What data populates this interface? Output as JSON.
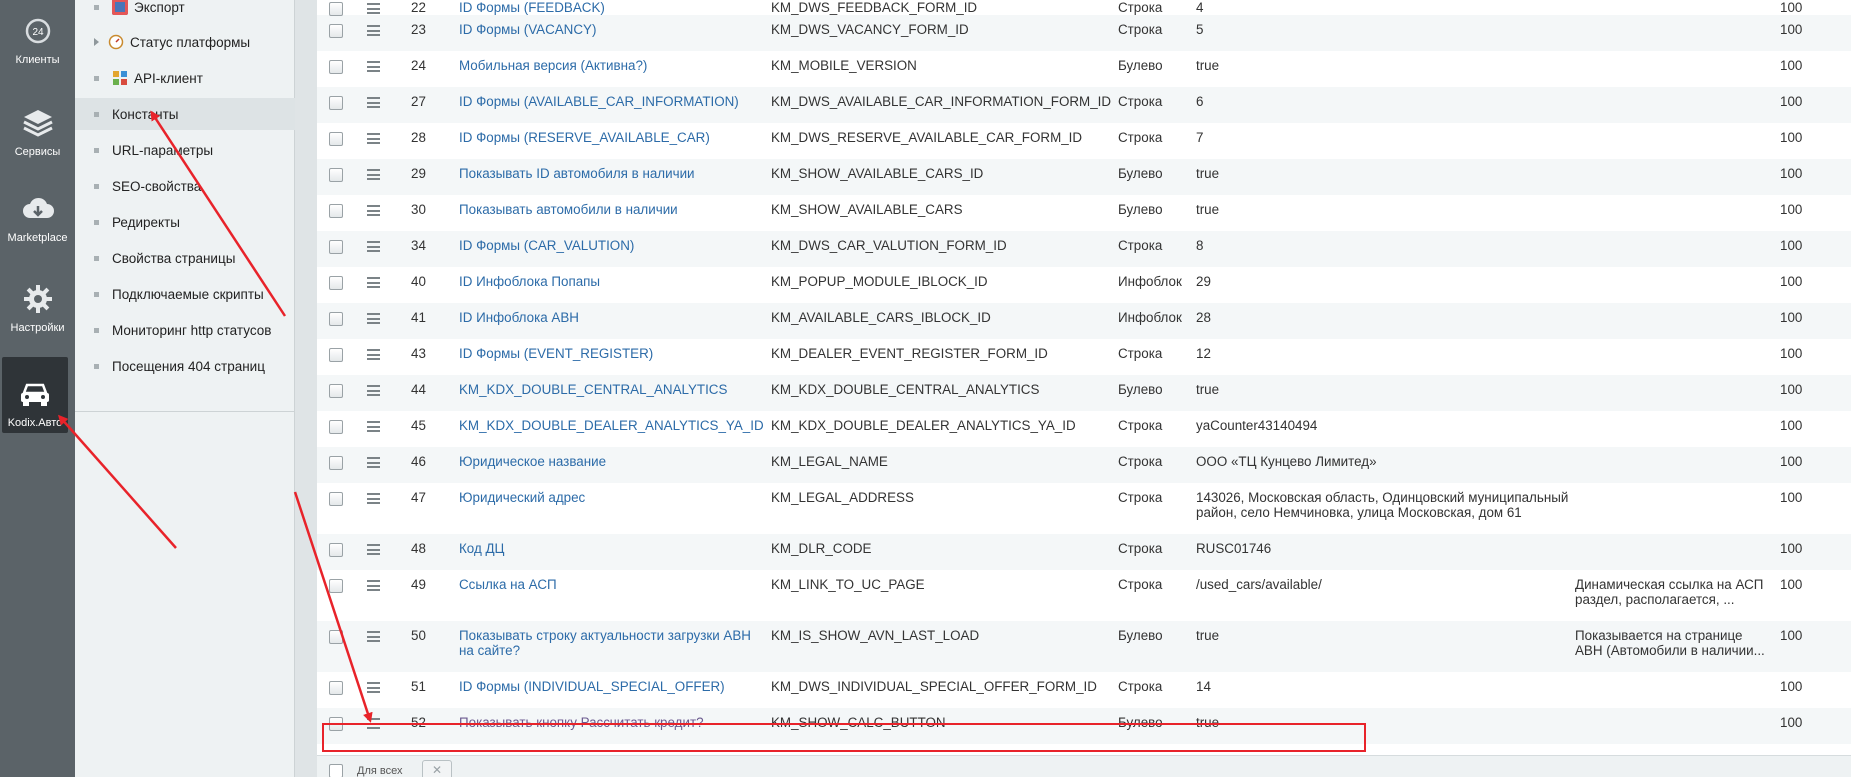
{
  "rail": {
    "items": [
      {
        "label": "Клиенты",
        "icon": "clients-24-icon"
      },
      {
        "label": "Сервисы",
        "icon": "layers-icon"
      },
      {
        "label": "Marketplace",
        "icon": "cloud-download-icon"
      },
      {
        "label": "Настройки",
        "icon": "gear-icon"
      },
      {
        "label": "Kodix.Авто",
        "icon": "car-icon"
      }
    ],
    "badge": "24"
  },
  "submenu": {
    "items": [
      {
        "label": "Экспорт"
      },
      {
        "label": "Статус платформы"
      },
      {
        "label": "API-клиент"
      },
      {
        "label": "Константы"
      },
      {
        "label": "URL-параметры"
      },
      {
        "label": "SEO-свойства"
      },
      {
        "label": "Редиректы"
      },
      {
        "label": "Свойства страницы"
      },
      {
        "label": "Подключаемые скрипты"
      },
      {
        "label": "Мониторинг http статусов"
      },
      {
        "label": "Посещения 404 страниц"
      }
    ]
  },
  "table": {
    "rows": [
      {
        "id": "22",
        "name": "ID Формы (FEEDBACK)",
        "code": "KM_DWS_FEEDBACK_FORM_ID",
        "type": "Строка",
        "value": "4",
        "desc": "",
        "sort": "100"
      },
      {
        "id": "23",
        "name": "ID Формы (VACANCY)",
        "code": "KM_DWS_VACANCY_FORM_ID",
        "type": "Строка",
        "value": "5",
        "desc": "",
        "sort": "100"
      },
      {
        "id": "24",
        "name": "Мобильная версия (Активна?)",
        "code": "KM_MOBILE_VERSION",
        "type": "Булево",
        "value": "true",
        "desc": "",
        "sort": "100"
      },
      {
        "id": "27",
        "name": "ID Формы (AVAILABLE_CAR_INFORMATION)",
        "code": "KM_DWS_AVAILABLE_CAR_INFORMATION_FORM_ID",
        "type": "Строка",
        "value": "6",
        "desc": "",
        "sort": "100"
      },
      {
        "id": "28",
        "name": "ID Формы (RESERVE_AVAILABLE_CAR)",
        "code": "KM_DWS_RESERVE_AVAILABLE_CAR_FORM_ID",
        "type": "Строка",
        "value": "7",
        "desc": "",
        "sort": "100"
      },
      {
        "id": "29",
        "name": "Показывать ID автомобиля в наличии",
        "code": "KM_SHOW_AVAILABLE_CARS_ID",
        "type": "Булево",
        "value": "true",
        "desc": "",
        "sort": "100"
      },
      {
        "id": "30",
        "name": "Показывать автомобили в наличии",
        "code": "KM_SHOW_AVAILABLE_CARS",
        "type": "Булево",
        "value": "true",
        "desc": "",
        "sort": "100"
      },
      {
        "id": "34",
        "name": "ID Формы (CAR_VALUTION)",
        "code": "KM_DWS_CAR_VALUTION_FORM_ID",
        "type": "Строка",
        "value": "8",
        "desc": "",
        "sort": "100"
      },
      {
        "id": "40",
        "name": "ID Инфоблока Попапы",
        "code": "KM_POPUP_MODULE_IBLOCK_ID",
        "type": "Инфоблок",
        "value": "29",
        "desc": "",
        "sort": "100"
      },
      {
        "id": "41",
        "name": "ID Инфоблока АВН",
        "code": "KM_AVAILABLE_CARS_IBLOCK_ID",
        "type": "Инфоблок",
        "value": "28",
        "desc": "",
        "sort": "100"
      },
      {
        "id": "43",
        "name": "ID Формы (EVENT_REGISTER)",
        "code": "KM_DEALER_EVENT_REGISTER_FORM_ID",
        "type": "Строка",
        "value": "12",
        "desc": "",
        "sort": "100"
      },
      {
        "id": "44",
        "name": "KM_KDX_DOUBLE_CENTRAL_ANALYTICS",
        "code": "KM_KDX_DOUBLE_CENTRAL_ANALYTICS",
        "type": "Булево",
        "value": "true",
        "desc": "",
        "sort": "100"
      },
      {
        "id": "45",
        "name": "KM_KDX_DOUBLE_DEALER_ANALYTICS_YA_ID",
        "code": "KM_KDX_DOUBLE_DEALER_ANALYTICS_YA_ID",
        "type": "Строка",
        "value": "yaCounter43140494",
        "desc": "",
        "sort": "100"
      },
      {
        "id": "46",
        "name": "Юридическое название",
        "code": "KM_LEGAL_NAME",
        "type": "Строка",
        "value": "ООО «ТЦ Кунцево Лимитед»",
        "desc": "",
        "sort": "100"
      },
      {
        "id": "47",
        "name": "Юридический адрес",
        "code": "KM_LEGAL_ADDRESS",
        "type": "Строка",
        "value": "143026, Московская область, Одинцовский муниципальный район, село Немчиновка, улица Московская, дом 61",
        "desc": "",
        "sort": "100"
      },
      {
        "id": "48",
        "name": "Код ДЦ",
        "code": "KM_DLR_CODE",
        "type": "Строка",
        "value": "RUSC01746",
        "desc": "",
        "sort": "100"
      },
      {
        "id": "49",
        "name": "Ссылка на АСП",
        "code": "KM_LINK_TO_UC_PAGE",
        "type": "Строка",
        "value": "/used_cars/available/",
        "desc": "Динамическая ссылка на АСП раздел, располагается, ...",
        "sort": "100"
      },
      {
        "id": "50",
        "name": "Показывать строку актуальности загрузки АВН на сайте?",
        "code": "KM_IS_SHOW_AVN_LAST_LOAD",
        "type": "Булево",
        "value": "true",
        "desc": "Показывается на странице АВН (Автомобили в наличии...",
        "sort": "100"
      },
      {
        "id": "51",
        "name": "ID Формы (INDIVIDUAL_SPECIAL_OFFER)",
        "code": "KM_DWS_INDIVIDUAL_SPECIAL_OFFER_FORM_ID",
        "type": "Строка",
        "value": "14",
        "desc": "",
        "sort": "100"
      },
      {
        "id": "52",
        "name": "Показывать кнопку Рассчитать кредит?",
        "code": "KM_SHOW_CALC_BUTTON",
        "type": "Булево",
        "value": "true",
        "desc": "",
        "sort": "100"
      }
    ]
  },
  "bottom": {
    "label": "Для всех",
    "cancel": "✕"
  },
  "colors": {
    "rail": "#5b6368",
    "rail_active": "#2f3438",
    "link": "#2c6ba8",
    "visited_link": "#6b5a8f",
    "annotation": "#e8232a"
  }
}
